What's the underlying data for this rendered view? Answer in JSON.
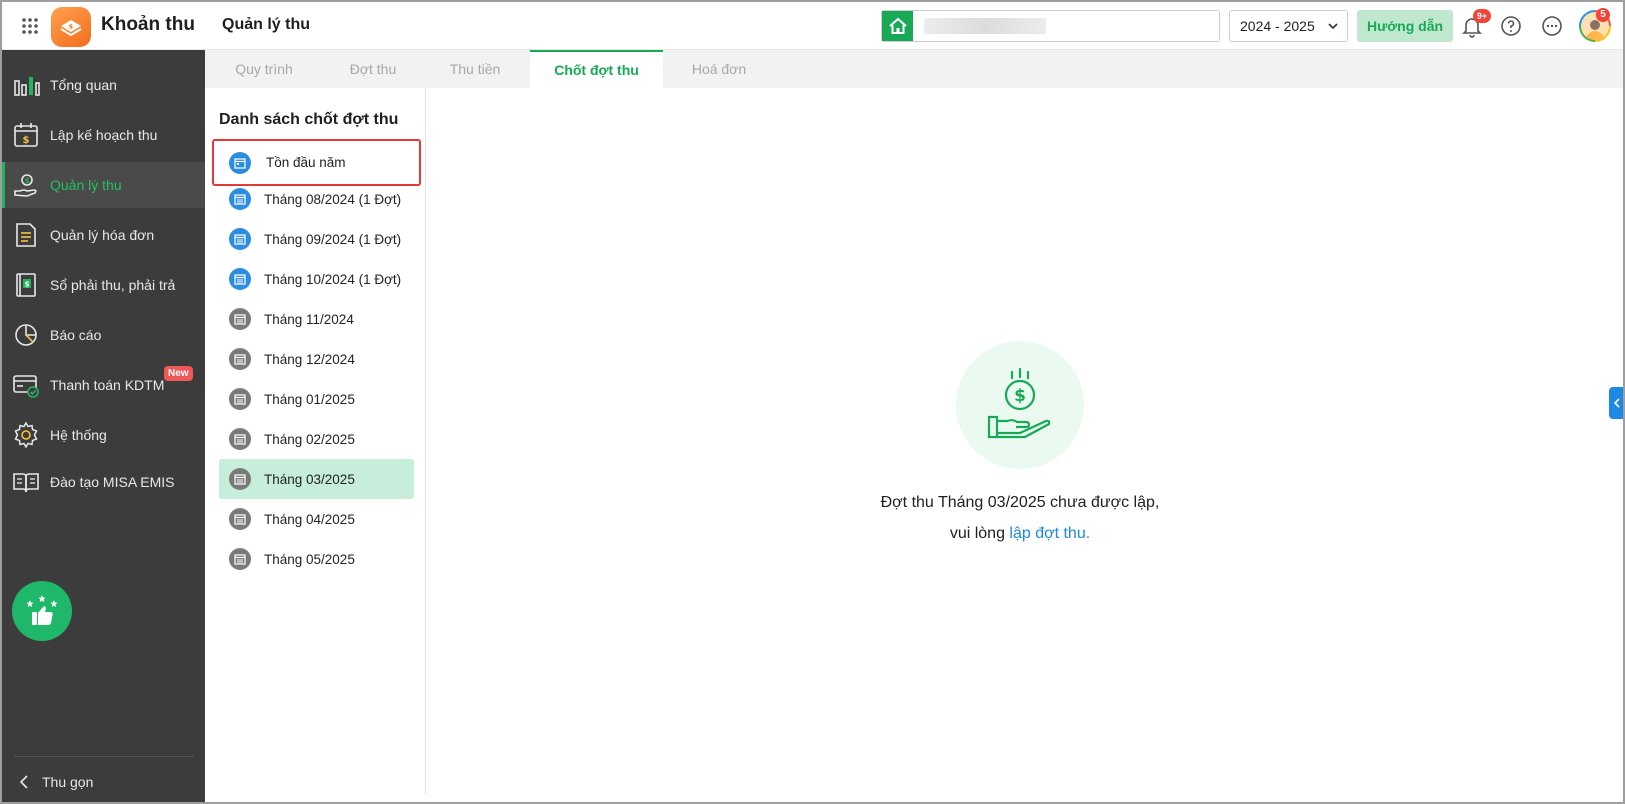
{
  "header": {
    "app_name": "Khoản thu",
    "page_title": "Quản lý thu",
    "school_search_value": "",
    "year_select_value": "2024 - 2025",
    "guide_button": "Hướng dẫn",
    "notification_count": "9+",
    "avatar_badge_count": "5"
  },
  "sidebar": {
    "items": [
      {
        "label": "Tổng quan",
        "icon": "bar-chart-icon"
      },
      {
        "label": "Lập kế hoạch thu",
        "icon": "calendar-dollar-icon"
      },
      {
        "label": "Quản lý thu",
        "icon": "hand-coin-icon",
        "active": true
      },
      {
        "label": "Quản lý hóa đơn",
        "icon": "invoice-icon"
      },
      {
        "label": "Sổ phải thu, phải trả",
        "icon": "ledger-book-icon"
      },
      {
        "label": "Báo cáo",
        "icon": "pie-chart-icon"
      },
      {
        "label": "Thanh toán KDTM",
        "icon": "card-payment-icon",
        "badge": "New"
      },
      {
        "label": "Hệ thống",
        "icon": "gear-icon"
      },
      {
        "label": "Đào tạo MISA EMIS",
        "icon": "open-book-icon"
      }
    ],
    "collapse_label": "Thu gọn"
  },
  "tabs": [
    {
      "label": "Quy trình"
    },
    {
      "label": "Đợt thu"
    },
    {
      "label": "Thu tiền"
    },
    {
      "label": "Chốt đợt thu",
      "active": true
    },
    {
      "label": "Hoá đơn"
    }
  ],
  "list_panel": {
    "title": "Danh sách chốt đợt thu",
    "items": [
      {
        "label": "Tồn đầu năm",
        "state": "outlined",
        "icon_color": "blue"
      },
      {
        "label": "Tháng 08/2024 (1 Đợt)",
        "icon_color": "blue"
      },
      {
        "label": "Tháng 09/2024 (1 Đợt)",
        "icon_color": "blue"
      },
      {
        "label": "Tháng 10/2024 (1 Đợt)",
        "icon_color": "blue"
      },
      {
        "label": "Tháng 11/2024",
        "icon_color": "grey"
      },
      {
        "label": "Tháng 12/2024",
        "icon_color": "grey"
      },
      {
        "label": "Tháng 01/2025",
        "icon_color": "grey"
      },
      {
        "label": "Tháng 02/2025",
        "icon_color": "grey"
      },
      {
        "label": "Tháng 03/2025",
        "icon_color": "grey",
        "state": "selected"
      },
      {
        "label": "Tháng 04/2025",
        "icon_color": "grey"
      },
      {
        "label": "Tháng 05/2025",
        "icon_color": "grey"
      }
    ]
  },
  "main": {
    "empty_message_line1": "Đợt thu Tháng 03/2025 chưa được lập,",
    "empty_message_prefix": "vui lòng ",
    "empty_message_link": "lập đợt thu."
  },
  "colors": {
    "brand_green": "#18a957",
    "sidebar_bg": "#3c3c3c",
    "selected_row_bg": "#c6eedb",
    "link_blue": "#1e88e5",
    "highlight_red": "#e53935"
  }
}
